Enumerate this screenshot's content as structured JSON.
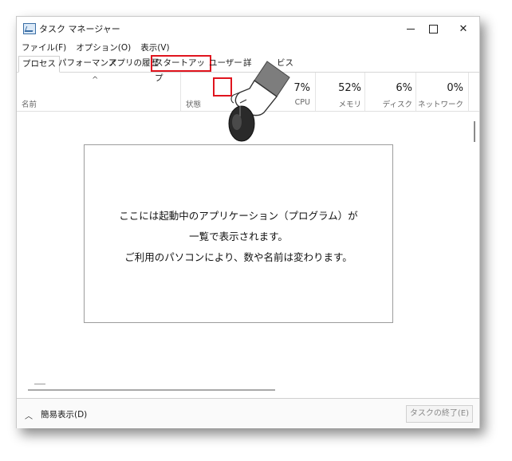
{
  "window": {
    "title": "タスク マネージャー"
  },
  "window_controls": {
    "minimize": "minimize",
    "maximize": "maximize",
    "close": "✕"
  },
  "menu": [
    "ファイル(F)",
    "オプション(O)",
    "表示(V)"
  ],
  "tabs": [
    {
      "label": "プロセス"
    },
    {
      "label": "パフォーマンス"
    },
    {
      "label": "アプリの履歴"
    },
    {
      "label": "スタートアップ"
    },
    {
      "label": "ユーザー"
    },
    {
      "label": "詳"
    },
    {
      "label": "ビス"
    }
  ],
  "columns": {
    "name": "名前",
    "status": "状態",
    "cpu": {
      "pct": "7%",
      "label": "CPU"
    },
    "memory": {
      "pct": "52%",
      "label": "メモリ"
    },
    "disk": {
      "pct": "6%",
      "label": "ディスク"
    },
    "network": {
      "pct": "0%",
      "label": "ネットワーク"
    }
  },
  "info": {
    "line1": "ここには起動中のアプリケーション（プログラム）が",
    "line2": "一覧で表示されます。",
    "line3": "ご利用のパソコンにより、数や名前は変わります。"
  },
  "footer": {
    "fewer_details": "簡易表示(D)",
    "end_task": "タスクの終了(E)"
  },
  "colors": {
    "highlight": "#e0141e",
    "window_border": "#c8c8c8"
  }
}
